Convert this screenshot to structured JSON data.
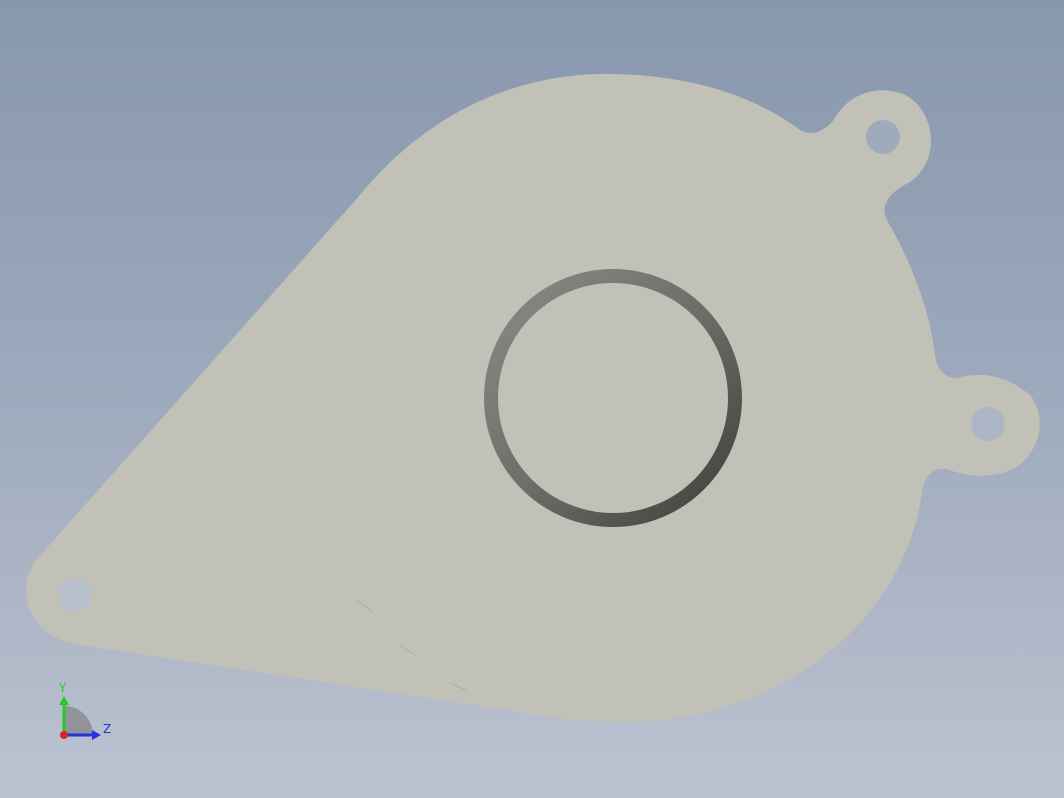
{
  "viewport": {
    "background_top": "#8797ad",
    "background_bottom": "#bcc2d0"
  },
  "part": {
    "face_color": "#c2c1b7",
    "ring_color": "#6c6c68",
    "hole_color": "#9eabbd"
  },
  "triad": {
    "y_label": "Y",
    "z_label": "Z",
    "y_color": "#22cc22",
    "z_color": "#2233dd",
    "x_color": "#dd2222"
  }
}
